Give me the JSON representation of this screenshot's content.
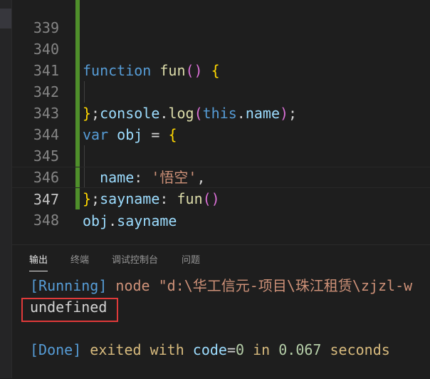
{
  "editor": {
    "lines": [
      {
        "number": "339"
      },
      {
        "number": "340"
      },
      {
        "number": "341"
      },
      {
        "number": "342"
      },
      {
        "number": "343"
      },
      {
        "number": "344"
      },
      {
        "number": "345"
      },
      {
        "number": "346"
      },
      {
        "number": "347"
      },
      {
        "number": "348"
      }
    ],
    "tokens": {
      "function_kw": "function",
      "fun_name": "fun",
      "paren_open": "(",
      "paren_close": ")",
      "brace_open": "{",
      "brace_close": "}",
      "console": "console",
      "dot": ".",
      "log": "log",
      "this": "this",
      "name": "name",
      "semicolon": ";",
      "var_kw": "var",
      "obj": "obj",
      "equals": "=",
      "name_key": "name",
      "colon": ":",
      "string_val": "'悟空'",
      "comma": ",",
      "sayname_key": "sayname",
      "fun_call": "fun",
      "obj_ref": "obj",
      "sayname_prop": "sayname"
    }
  },
  "panel": {
    "tabs": [
      "输出",
      "终端",
      "调试控制台",
      "问题"
    ],
    "output": {
      "running_tag": "[Running]",
      "running_cmd": "node \"d:\\华工信元-项目\\珠江租赁\\zjzl-w",
      "result": "undefined",
      "done_tag": "[Done]",
      "exited_with": "exited with",
      "code_label": "code",
      "code_eq": "=",
      "code_value": "0",
      "in_word": "in",
      "time_value": "0.067",
      "seconds_word": "seconds"
    }
  },
  "colors": {
    "background": "#1e1e1e",
    "keyword": "#569cd6",
    "function": "#dcdcaa",
    "variable": "#9cdcfe",
    "string": "#ce9178",
    "bracket_gold": "#ffd700",
    "bracket_purple": "#da70d6",
    "gutter_modified": "#4f8f2b",
    "highlight_box": "#e03a3a"
  }
}
